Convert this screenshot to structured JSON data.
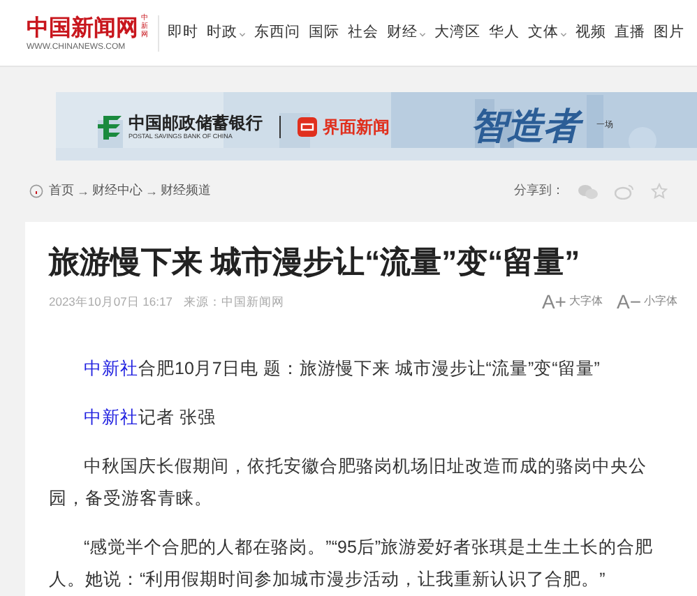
{
  "header": {
    "logo": "中国新闻网",
    "logo_tag": "中新网",
    "url": "WWW.CHINANEWS.COM",
    "nav": [
      {
        "label": "即时",
        "dropdown": false
      },
      {
        "label": "时政",
        "dropdown": true
      },
      {
        "label": "东西问",
        "dropdown": false
      },
      {
        "label": "国际",
        "dropdown": false
      },
      {
        "label": "社会",
        "dropdown": false
      },
      {
        "label": "财经",
        "dropdown": true
      },
      {
        "label": "大湾区",
        "dropdown": false
      },
      {
        "label": "华人",
        "dropdown": false
      },
      {
        "label": "文体",
        "dropdown": true
      },
      {
        "label": "视频",
        "dropdown": false
      },
      {
        "label": "直播",
        "dropdown": false
      },
      {
        "label": "图片",
        "dropdown": false
      }
    ]
  },
  "banner": {
    "kind": "picture",
    "bank": "中国邮政储蓄银行",
    "bank_en": "POSTAL SAVINGS BANK OF CHINA",
    "partner": "界面新闻",
    "slogan": "智造者",
    "slogan_tail": "一场"
  },
  "breadcrumb": {
    "separator": "→",
    "items": [
      "首页",
      "财经中心",
      "财经频道"
    ]
  },
  "share": {
    "label": "分享到："
  },
  "article": {
    "title": "旅游慢下来 城市漫步让“流量”变“留量”",
    "date": "2023年10月07日 16:17",
    "source": "来源：中国新闻网",
    "font_controls": [
      {
        "glyph": "A+",
        "label": "大字体"
      },
      {
        "glyph": "A−",
        "label": "小字体"
      }
    ],
    "paragraphs": [
      {
        "lead": "中新社",
        "text": "合肥10月7日电 题：旅游慢下来 城市漫步让“流量”变“留量”"
      },
      {
        "lead": "中新社",
        "text": "记者 张强"
      },
      {
        "text": "中秋国庆长假期间，依托安徽合肥骆岗机场旧址改造而成的骆岗中央公园，备受游客青睐。"
      },
      {
        "text": "“感觉半个合肥的人都在骆岗。”“95后”旅游爱好者张琪是土生土长的合肥人。她说：“利用假期时间参加城市漫步活动，让我重新认识了合肥。”"
      }
    ]
  }
}
